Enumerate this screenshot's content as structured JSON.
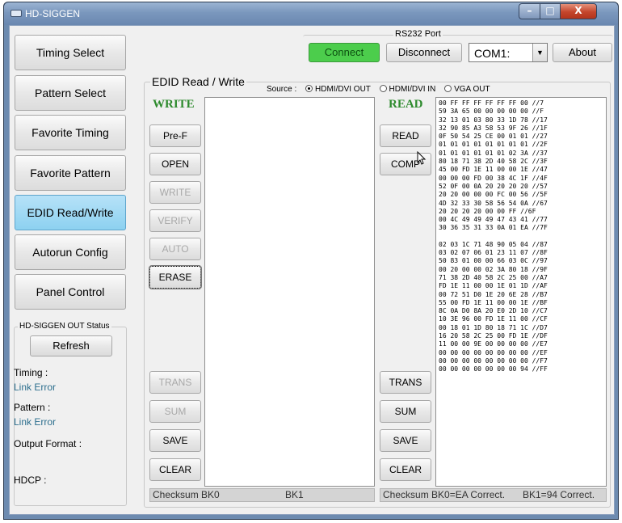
{
  "window": {
    "title": "HD-SIGGEN",
    "controls": {
      "minimize": "–",
      "maximize": "□",
      "close": "X"
    }
  },
  "nav": [
    {
      "label": "Timing Select"
    },
    {
      "label": "Pattern Select"
    },
    {
      "label": "Favorite Timing"
    },
    {
      "label": "Favorite Pattern"
    },
    {
      "label": "EDID Read/Write",
      "active": true
    },
    {
      "label": "Autorun Config"
    },
    {
      "label": "Panel Control"
    }
  ],
  "rs232": {
    "title": "RS232 Port",
    "connect": "Connect",
    "disconnect": "Disconnect",
    "port": "COM1:",
    "about": "About"
  },
  "status_panel": {
    "title": "HD-SIGGEN OUT Status",
    "refresh": "Refresh",
    "timing_label": "Timing :",
    "timing_value": "Link Error",
    "pattern_label": "Pattern :",
    "pattern_value": "Link Error",
    "output_format_label": "Output Format :",
    "hdcp_label": "HDCP :"
  },
  "edid": {
    "title": "EDID Read / Write",
    "source_label": "Source :",
    "source_options": [
      "HDMI/DVI OUT",
      "HDMI/DVI IN",
      "VGA OUT"
    ],
    "source_selected": "HDMI/DVI OUT",
    "write_heading": "WRITE",
    "read_heading": "READ",
    "write_buttons": {
      "pref": "Pre-F",
      "open": "OPEN",
      "write": "WRITE",
      "verify": "VERIFY",
      "auto": "AUTO",
      "erase": "ERASE",
      "trans": "TRANS",
      "sum": "SUM",
      "save": "SAVE",
      "clear": "CLEAR"
    },
    "read_buttons": {
      "read": "READ",
      "comp": "COMP",
      "trans": "TRANS",
      "sum": "SUM",
      "save": "SAVE",
      "clear": "CLEAR"
    },
    "write_status": {
      "bk0": "Checksum BK0",
      "bk1": "BK1"
    },
    "read_status": {
      "bk0": "Checksum BK0=EA Correct.",
      "bk1": "BK1=94 Correct."
    },
    "hex_block0": [
      "00 FF FF FF FF FF FF 00 //7",
      "59 3A 65 00 00 00 00 00 //F",
      "32 13 01 03 80 33 1D 78 //17",
      "32 90 85 A3 58 53 9F 26 //1F",
      "0F 50 54 25 CE 00 01 01 //27",
      "01 01 01 01 01 01 01 01 //2F",
      "01 01 01 01 01 01 02 3A //37",
      "80 18 71 38 2D 40 58 2C //3F",
      "45 00 FD 1E 11 00 00 1E //47",
      "00 00 00 FD 00 38 4C 1F //4F",
      "52 0F 00 0A 20 20 20 20 //57",
      "20 20 00 00 00 FC 00 56 //5F",
      "4D 32 33 30 58 56 54 0A //67",
      "20 20 20 20 00 00 FF //6F",
      "00 4C 49 49 49 47 43 41 //77",
      "30 36 35 31 33 0A 01 EA //7F"
    ],
    "hex_block1": [
      "02 03 1C 71 48 90 05 04 //87",
      "03 02 07 06 01 23 11 07 //8F",
      "50 83 01 00 00 66 03 0C //97",
      "00 20 00 00 02 3A 80 18 //9F",
      "71 38 2D 40 58 2C 25 00 //A7",
      "FD 1E 11 00 00 1E 01 1D //AF",
      "00 72 51 D0 1E 20 6E 28 //B7",
      "55 00 FD 1E 11 00 00 1E //BF",
      "8C 0A D0 8A 20 E0 2D 10 //C7",
      "10 3E 96 00 FD 1E 11 00 //CF",
      "00 18 01 1D 80 18 71 1C //D7",
      "16 20 58 2C 25 00 FD 1E //DF",
      "11 00 00 9E 00 00 00 00 //E7",
      "00 00 00 00 00 00 00 00 //EF",
      "00 00 00 00 00 00 00 00 //F7",
      "00 00 00 00 00 00 00 94 //FF"
    ]
  },
  "colors": {
    "connect_green": "#4ccd4c",
    "active_nav": "#8dd1f0",
    "heading_green": "#2e8b2e",
    "heading_blue": "#1f5fa8",
    "link_text": "#2d6f8e"
  }
}
